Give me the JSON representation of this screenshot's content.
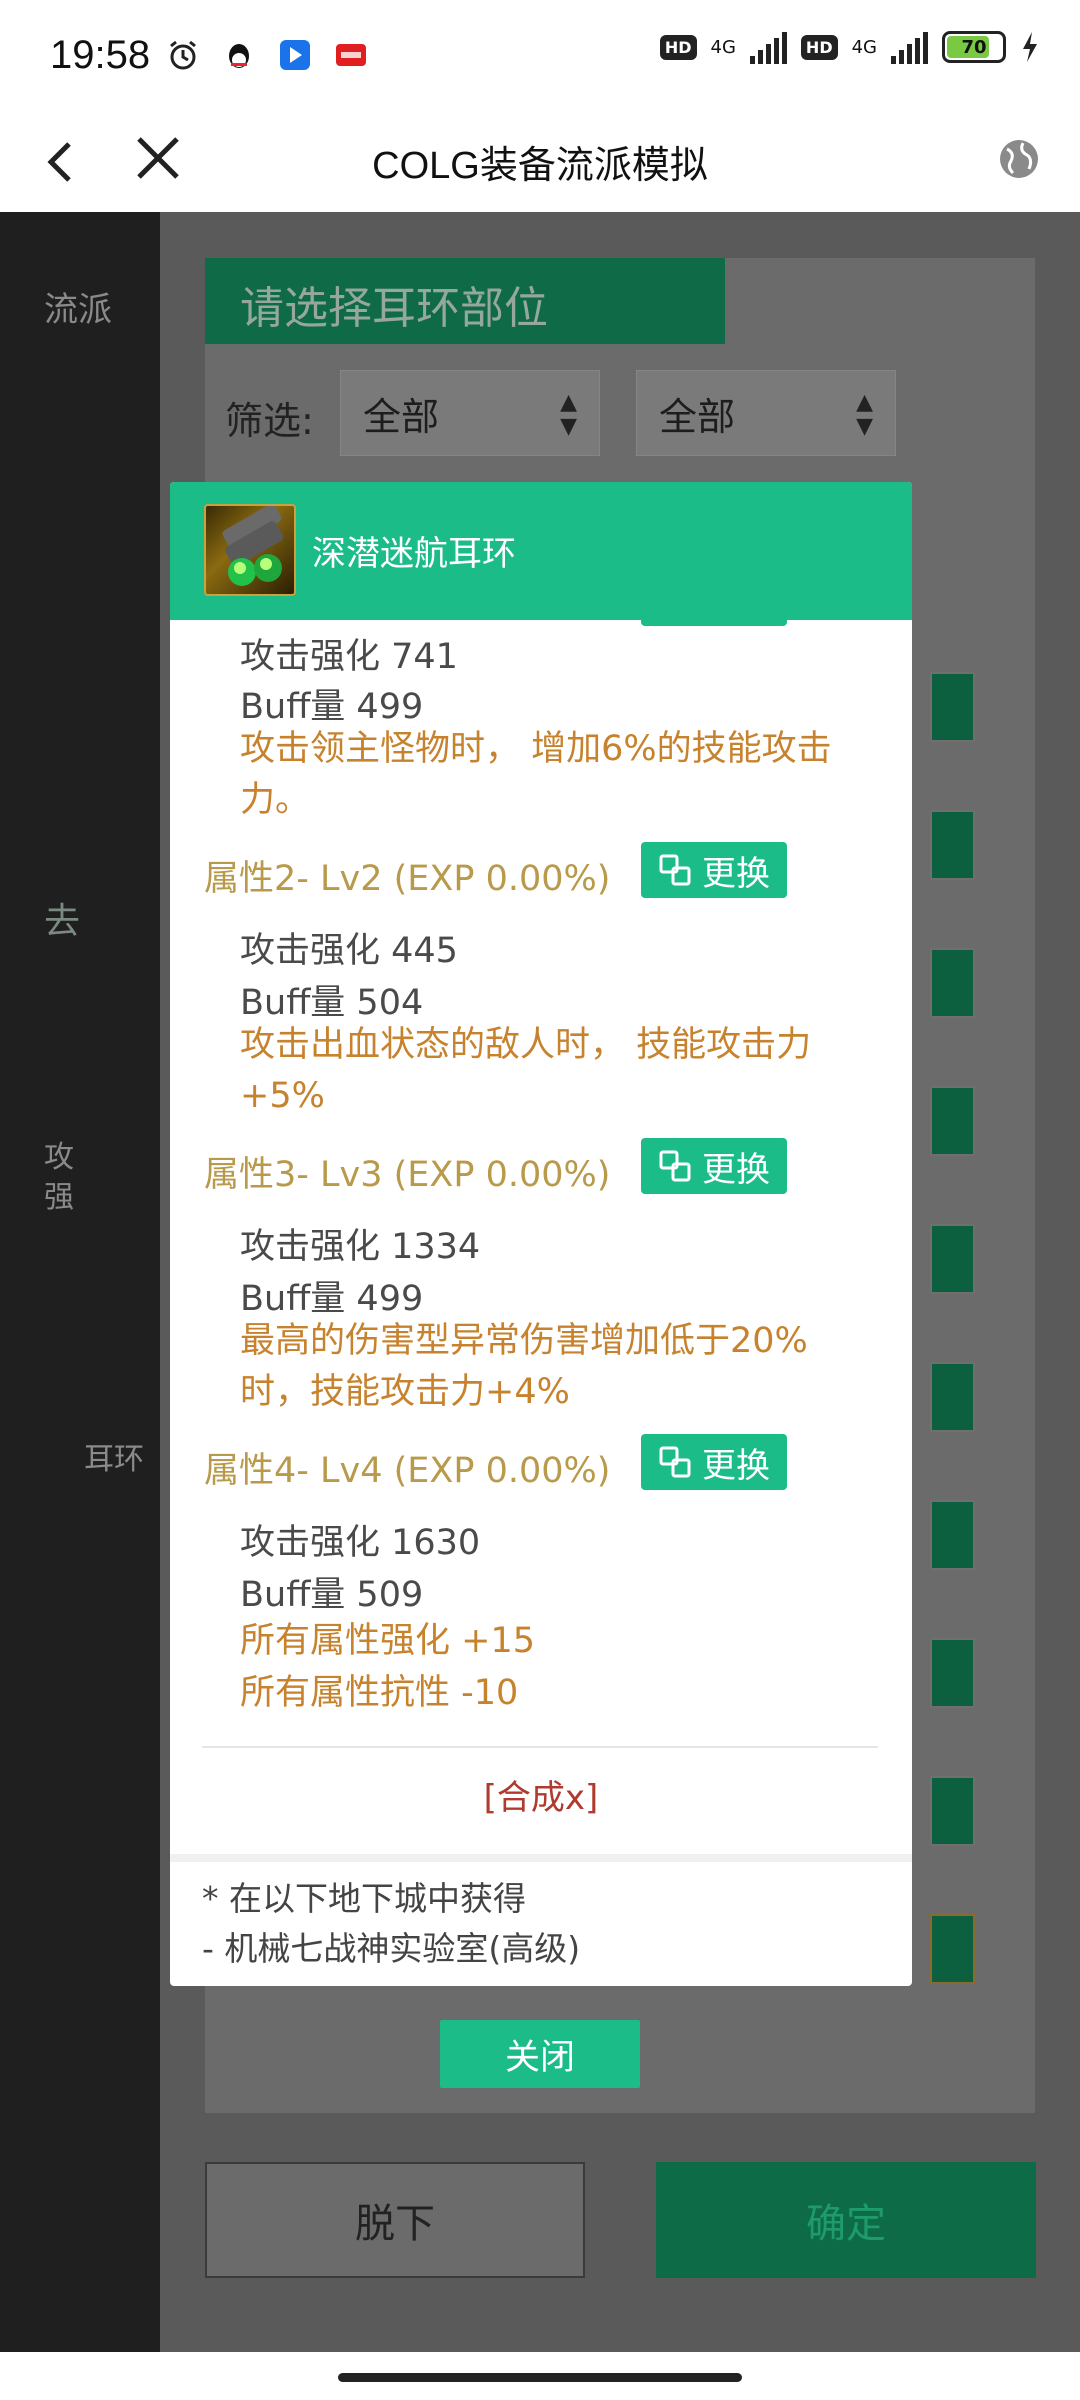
{
  "status_bar": {
    "time": "19:58",
    "hd1": "HD",
    "net1": "4G",
    "hd2": "HD",
    "net2": "4G",
    "battery": "70"
  },
  "title_bar": {
    "title": "COLG装备流派模拟"
  },
  "background": {
    "left_fragments": [
      "流派",
      "去",
      "攻",
      "强",
      "耳环"
    ],
    "panel_header": "请选择耳环部位",
    "filter_label": "筛选:",
    "select1": "全部",
    "select2": "全部",
    "remove_button": "脱下",
    "confirm_button": "确定"
  },
  "modal": {
    "item_name": "深潜迷航耳环",
    "attr1": {
      "stat1": "攻击强化 741",
      "stat2": "Buff量 499",
      "desc": "攻击领主怪物时， 增加6%的技能攻击力。"
    },
    "attr2": {
      "title": "属性2- Lv2 (EXP 0.00%)",
      "swap": "更换",
      "stat1": "攻击强化 445",
      "stat2": "Buff量 504",
      "desc": "攻击出血状态的敌人时， 技能攻击力 +5%"
    },
    "attr3": {
      "title": "属性3- Lv3 (EXP 0.00%)",
      "swap": "更换",
      "stat1": "攻击强化 1334",
      "stat2": "Buff量 499",
      "desc": "最高的伤害型异常伤害增加低于20%时，技能攻击力+4%"
    },
    "attr4": {
      "title": "属性4- Lv4 (EXP 0.00%)",
      "swap": "更换",
      "stat1": "攻击强化 1630",
      "stat2": "Buff量 509",
      "desc1": "所有属性强化 +15",
      "desc2": "所有属性抗性 -10"
    },
    "synth": "[合成x]",
    "source_title": "* 在以下地下城中获得",
    "source_item": "- 机械七战神实验室(高级)",
    "close": "关闭"
  },
  "colors": {
    "accent": "#1bbc88",
    "desc": "#c7822e",
    "attr_title": "#b89a4a",
    "synth": "#b03a2e"
  }
}
